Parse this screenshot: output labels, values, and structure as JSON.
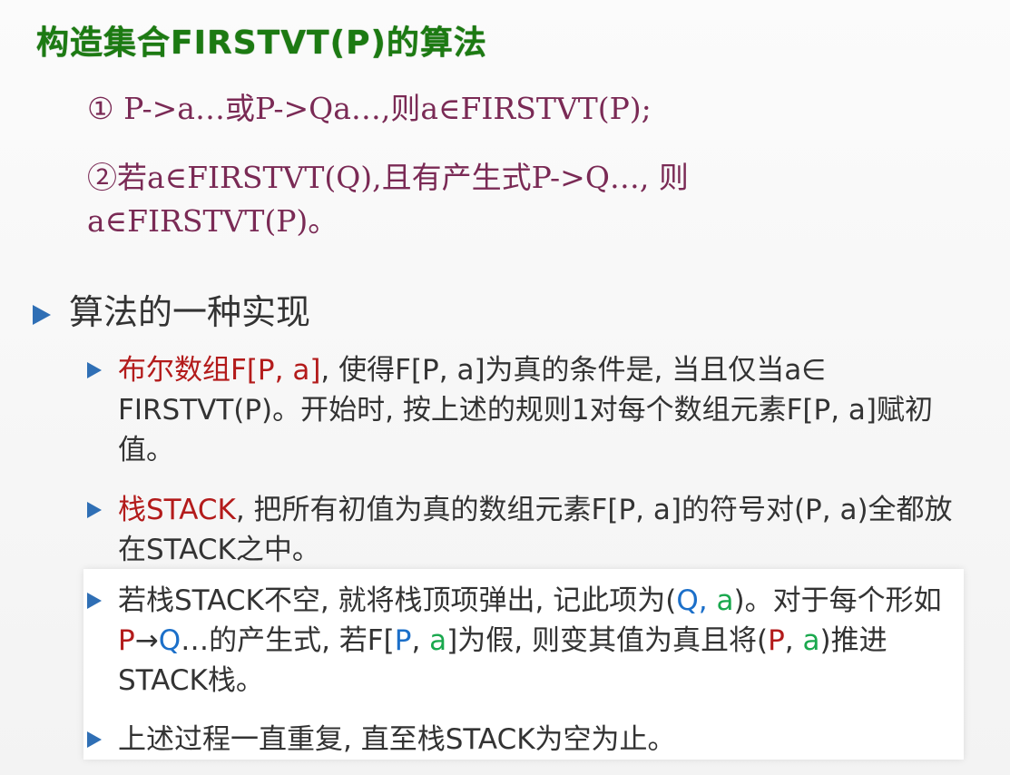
{
  "title": "构造集合FIRSTVT(P)的算法",
  "rules": {
    "r1": "① P->a…或P->Qa…,则a∈FIRSTVT(P);",
    "r2": "②若a∈FIRSTVT(Q),且有产生式P->Q…, 则 a∈FIRSTVT(P)。"
  },
  "main_bullet": "算法的一种实现",
  "sub1": {
    "highlight": "布尔数组F[P, a]",
    "rest": ", 使得F[P, a]为真的条件是, 当且仅当a∈ FIRSTVT(P)。开始时, 按上述的规则1对每个数组元素F[P, a]赋初值。"
  },
  "sub2": {
    "highlight": "栈STACK",
    "rest": ", 把所有初值为真的数组元素F[P, a]的符号对(P, a)全都放在STACK之中。"
  },
  "sub3": {
    "t1": "若栈STACK不空, 就将栈顶项弹出, 记此项为(",
    "Q": "Q",
    "comma": ", ",
    "a1": "a",
    "t2": ")。对于每个形如",
    "P": "P",
    "arrow": "→",
    "Q2": "Q",
    "t3": "…的产生式, 若F[",
    "P2": "P",
    "comma2": ", ",
    "a2": "a",
    "t4": "]为假, 则变其值为真且将(",
    "P3": "P",
    "comma3": ", ",
    "a3": "a",
    "t5": ")推进STACK栈。"
  },
  "sub4": "上述过程一直重复, 直至栈STACK为空为止。"
}
